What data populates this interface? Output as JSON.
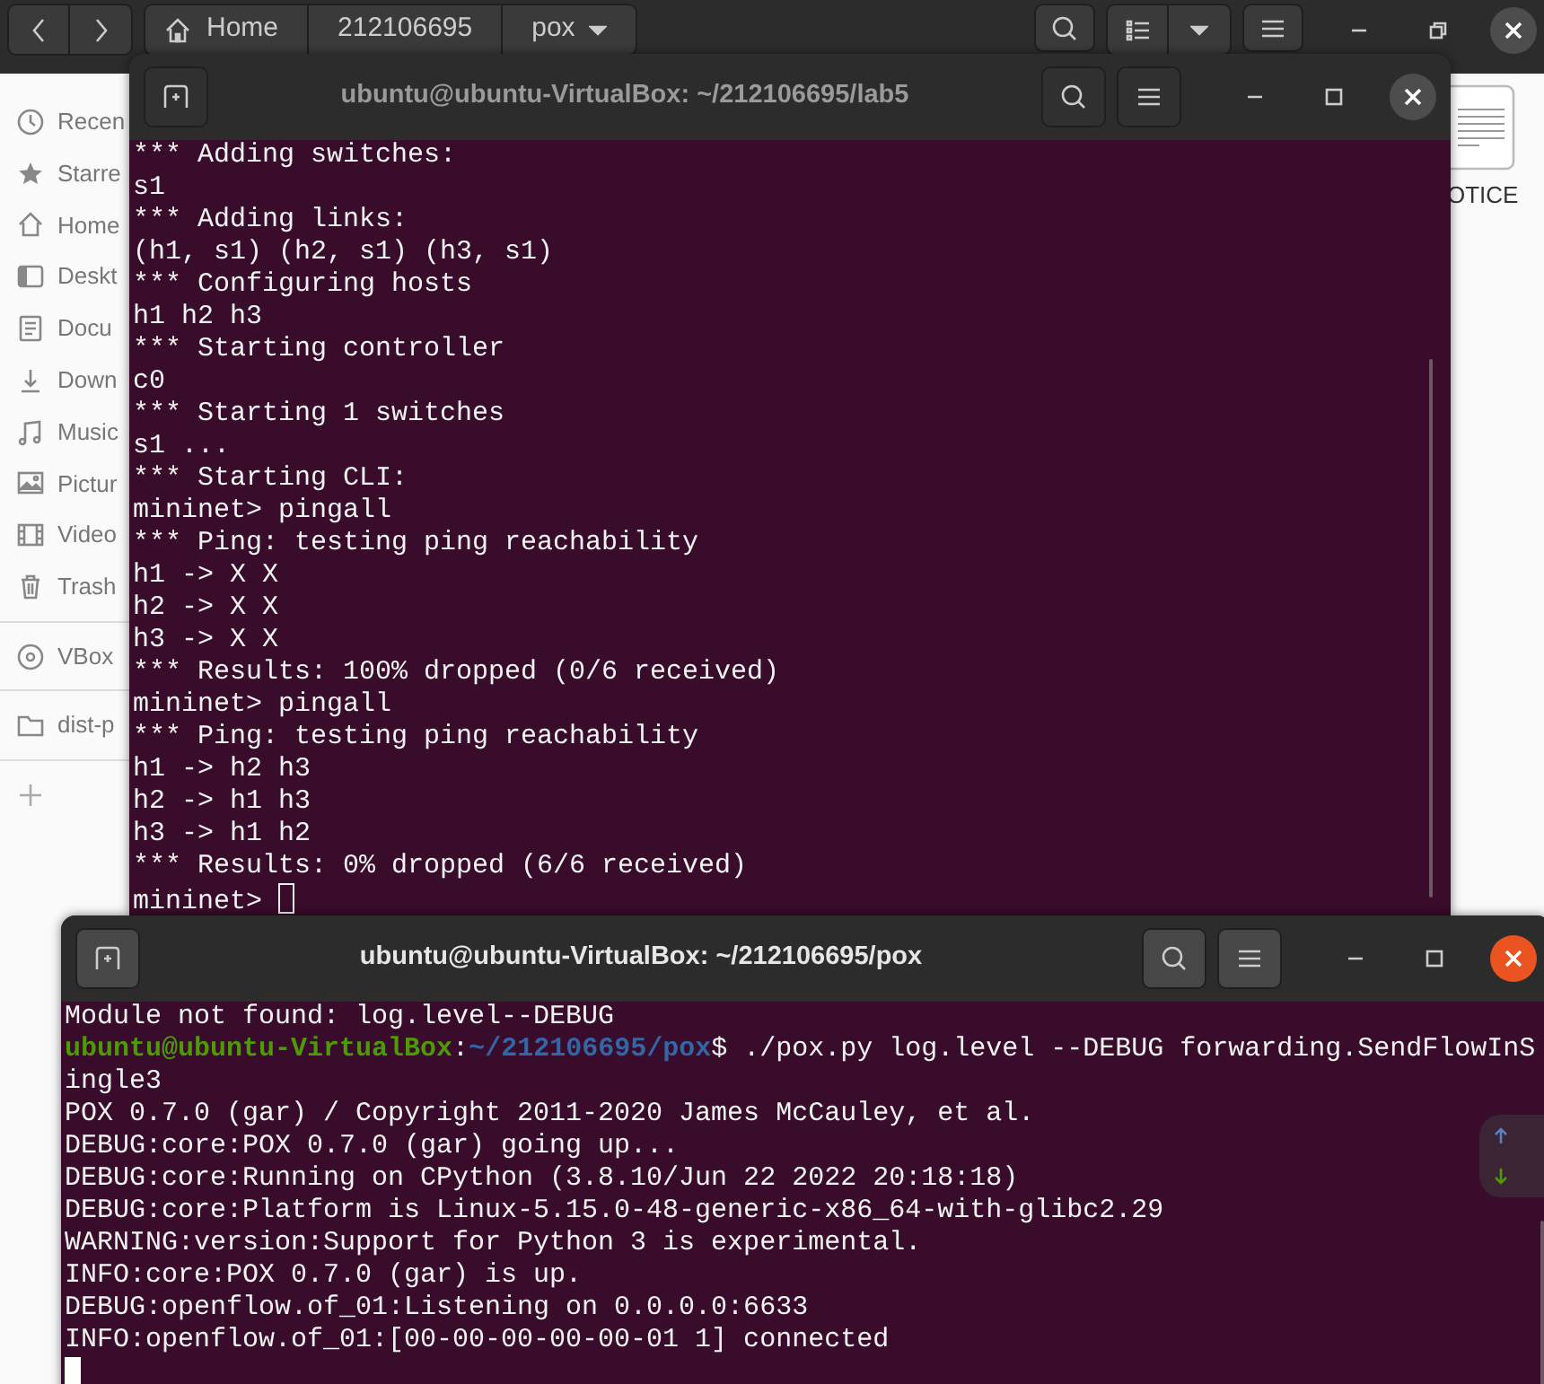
{
  "file_manager": {
    "path": [
      {
        "label": "Home",
        "kind": "home"
      },
      {
        "label": "212106695",
        "kind": "folder"
      },
      {
        "label": "pox",
        "kind": "current"
      }
    ],
    "sidebar": [
      [
        {
          "label": "Recen",
          "kind": "recent"
        },
        {
          "label": "Starre",
          "kind": "starred"
        },
        {
          "label": "Home",
          "kind": "home"
        },
        {
          "label": "Deskt",
          "kind": "desktop"
        },
        {
          "label": "Docu",
          "kind": "documents"
        },
        {
          "label": "Down",
          "kind": "downloads"
        },
        {
          "label": "Music",
          "kind": "music"
        },
        {
          "label": "Pictur",
          "kind": "pictures"
        },
        {
          "label": "Video",
          "kind": "videos"
        },
        {
          "label": "Trash",
          "kind": "trash"
        }
      ],
      [
        {
          "label": "VBox",
          "kind": "disc"
        }
      ],
      [
        {
          "label": "dist-p",
          "kind": "folder"
        }
      ]
    ],
    "files": [
      {
        "label": "OTICE",
        "kind": "text"
      }
    ]
  },
  "terminals": [
    {
      "title": "ubuntu@ubuntu-VirtualBox: ~/212106695/lab5",
      "focused": false,
      "cursor_on_new_line": false,
      "lines": [
        {
          "kind": "output",
          "text": "*** Adding switches:"
        },
        {
          "kind": "output",
          "text": "s1"
        },
        {
          "kind": "output",
          "text": "*** Adding links:"
        },
        {
          "kind": "output",
          "text": "(h1, s1) (h2, s1) (h3, s1)"
        },
        {
          "kind": "output",
          "text": "*** Configuring hosts"
        },
        {
          "kind": "output",
          "text": "h1 h2 h3"
        },
        {
          "kind": "output",
          "text": "*** Starting controller"
        },
        {
          "kind": "output",
          "text": "c0"
        },
        {
          "kind": "output",
          "text": "*** Starting 1 switches"
        },
        {
          "kind": "output",
          "text": "s1 ..."
        },
        {
          "kind": "output",
          "text": "*** Starting CLI:"
        },
        {
          "kind": "output",
          "text": "mininet> pingall"
        },
        {
          "kind": "output",
          "text": "*** Ping: testing ping reachability"
        },
        {
          "kind": "output",
          "text": "h1 -> X X"
        },
        {
          "kind": "output",
          "text": "h2 -> X X"
        },
        {
          "kind": "output",
          "text": "h3 -> X X"
        },
        {
          "kind": "output",
          "text": "*** Results: 100% dropped (0/6 received)"
        },
        {
          "kind": "output",
          "text": "mininet> pingall"
        },
        {
          "kind": "output",
          "text": "*** Ping: testing ping reachability"
        },
        {
          "kind": "output",
          "text": "h1 -> h2 h3"
        },
        {
          "kind": "output",
          "text": "h2 -> h1 h3"
        },
        {
          "kind": "output",
          "text": "h3 -> h1 h2"
        },
        {
          "kind": "output",
          "text": "*** Results: 0% dropped (6/6 received)"
        },
        {
          "kind": "output",
          "text": "mininet> "
        }
      ]
    },
    {
      "title": "ubuntu@ubuntu-VirtualBox: ~/212106695/pox",
      "focused": true,
      "cursor_on_new_line": true,
      "lines": [
        {
          "kind": "output",
          "text": "Module not found: log.level--DEBUG"
        },
        {
          "kind": "prompt",
          "user": "ubuntu@ubuntu-VirtualBox",
          "separator": ":",
          "path": "~/212106695/pox",
          "sign": "$",
          "command": "./pox.py log.level --DEBUG forwarding.SendFlowInSingle3"
        },
        {
          "kind": "output",
          "text": "POX 0.7.0 (gar) / Copyright 2011-2020 James McCauley, et al."
        },
        {
          "kind": "output",
          "text": "DEBUG:core:POX 0.7.0 (gar) going up..."
        },
        {
          "kind": "output",
          "text": "DEBUG:core:Running on CPython (3.8.10/Jun 22 2022 20:18:18)"
        },
        {
          "kind": "output",
          "text": "DEBUG:core:Platform is Linux-5.15.0-48-generic-x86_64-with-glibc2.29"
        },
        {
          "kind": "output",
          "text": "WARNING:version:Support for Python 3 is experimental."
        },
        {
          "kind": "output",
          "text": "INFO:core:POX 0.7.0 (gar) is up."
        },
        {
          "kind": "output",
          "text": "DEBUG:openflow.of_01:Listening on 0.0.0.0:6633"
        },
        {
          "kind": "output",
          "text": "INFO:openflow.of_01:[00-00-00-00-00-01 1] connected"
        }
      ]
    }
  ]
}
